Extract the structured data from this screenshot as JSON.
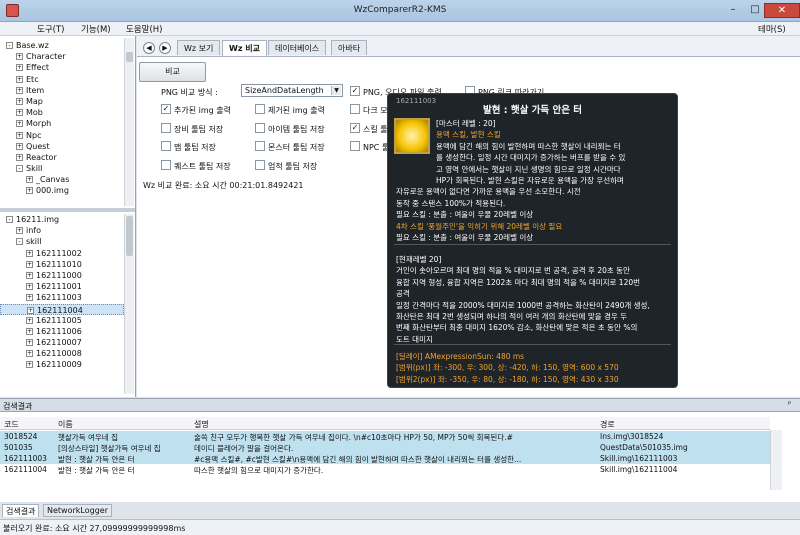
{
  "window": {
    "title": "WzComparerR2-KMS",
    "minimize": "–",
    "maximize": "□",
    "close": "✕"
  },
  "menu": {
    "tools": "도구(T)",
    "functions": "기능(M)",
    "help": "도움말(H)",
    "theme": "테마(S)"
  },
  "tree_top": {
    "items": [
      {
        "label": "Base.wz",
        "indent": 0,
        "exp": "-"
      },
      {
        "label": "Character",
        "indent": 1,
        "exp": "+"
      },
      {
        "label": "Effect",
        "indent": 1,
        "exp": "+"
      },
      {
        "label": "Etc",
        "indent": 1,
        "exp": "+"
      },
      {
        "label": "Item",
        "indent": 1,
        "exp": "+"
      },
      {
        "label": "Map",
        "indent": 1,
        "exp": "+"
      },
      {
        "label": "Mob",
        "indent": 1,
        "exp": "+"
      },
      {
        "label": "Morph",
        "indent": 1,
        "exp": "+"
      },
      {
        "label": "Npc",
        "indent": 1,
        "exp": "+"
      },
      {
        "label": "Quest",
        "indent": 1,
        "exp": "+"
      },
      {
        "label": "Reactor",
        "indent": 1,
        "exp": "+"
      },
      {
        "label": "Skill",
        "indent": 1,
        "exp": "-"
      },
      {
        "label": "_Canvas",
        "indent": 2,
        "exp": "+"
      },
      {
        "label": "000.img",
        "indent": 2,
        "exp": "+"
      }
    ]
  },
  "tree_bottom": {
    "items": [
      {
        "label": "16211.img",
        "indent": 0,
        "exp": "-"
      },
      {
        "label": "info",
        "indent": 1,
        "exp": "+"
      },
      {
        "label": "skill",
        "indent": 1,
        "exp": "-"
      },
      {
        "label": "162111002",
        "indent": 2,
        "exp": "+"
      },
      {
        "label": "162111010",
        "indent": 2,
        "exp": "+"
      },
      {
        "label": "162111000",
        "indent": 2,
        "exp": "+"
      },
      {
        "label": "162111001",
        "indent": 2,
        "exp": "+"
      },
      {
        "label": "162111003",
        "indent": 2,
        "exp": "+"
      },
      {
        "label": "162111004",
        "indent": 2,
        "exp": "+",
        "selected": true
      },
      {
        "label": "162111005",
        "indent": 2,
        "exp": "+"
      },
      {
        "label": "162111006",
        "indent": 2,
        "exp": "+"
      },
      {
        "label": "162110007",
        "indent": 2,
        "exp": "+"
      },
      {
        "label": "162110008",
        "indent": 2,
        "exp": "+"
      },
      {
        "label": "162110009",
        "indent": 2,
        "exp": "+"
      }
    ]
  },
  "tabs": [
    "Wz 보기",
    "Wz 비교",
    "데이터베이스",
    "아바타"
  ],
  "compare": {
    "compare_button": "비교",
    "png_mode_label": "PNG 비교 방식 :",
    "png_mode_value": "SizeAndDataLength",
    "opt_png_audio": "PNG, 오디오 파일 출력",
    "opt_png_link": "PNG 링크 따라가기",
    "opt_added_img": "추가된 img 출력",
    "opt_removed_img": "제거된 img 출력",
    "opt_other": "다크 모드",
    "opt_equip": "장비 툴팁 저장",
    "opt_item": "아이템 툴팁 저장",
    "opt_skill": "스킬 툴팁 저장",
    "opt_map": "맵 툴팁 저장",
    "opt_mob": "몬스터 툴팁 저장",
    "opt_npc": "NPC 툴팁 저장",
    "opt_quest": "퀘스트 툴팁 저장",
    "opt_achievement": "업적 툴팁 저장",
    "status": "Wz 비교 완료: 소요 시간 00:21:01.8492421"
  },
  "tooltip": {
    "id": "162111003",
    "title": "발현 : 햇살 가득 안은 터",
    "lines": [
      {
        "text": "[마스터 레벨 : 20]",
        "cls": ""
      },
      {
        "text": "용맥 스킬, 발현 스킬",
        "cls": "orange"
      },
      {
        "text": "용맥에 담긴 해의 힘이 발현하며 따스한 햇살이 내리쬐는 터",
        "cls": ""
      },
      {
        "text": "를 생성한다. 일정 시간 대미지가 증가하는 버프를 받을 수 있",
        "cls": ""
      },
      {
        "text": "고 영역 안에서는 햇살이 지닌 생명의 힘으로 일정 시간마다",
        "cls": ""
      },
      {
        "text": "HP가 회복된다. 발현 스킬은 자유로운 용맥을 가장 우선하며",
        "cls": ""
      },
      {
        "text": "자유로운 용맥이 없다면 가까운 용맥을 우선 소모한다. 시전",
        "cls": ""
      },
      {
        "text": "동작 중 스탠스 100%가 적용된다.",
        "cls": ""
      },
      {
        "text": "필요 스킬 : 분출 : 여울이 우물 20레벨 이상",
        "cls": ""
      },
      {
        "text": "4차 스킬 '풍월주인'을 익히기 위해 20레벨 이상 필요",
        "cls": "orange"
      },
      {
        "text": "필요 스킬 : 분출 : 여울이 우물 20레벨 이상",
        "cls": ""
      }
    ],
    "lines2": [
      {
        "text": "[현재레벨 20]",
        "cls": ""
      },
      {
        "text": "거인이 솟아오르며 최대 명의 적을 % 대미지로 번 공격, 공격 후 20초 동안",
        "cls": ""
      },
      {
        "text": "융합 지역 형성, 융합 지역은 1202초 마다 최대 명의 적을 % 대미지로 120번",
        "cls": ""
      },
      {
        "text": "공격",
        "cls": ""
      },
      {
        "text": "일정 간격마다 적을 2000% 대미지로 1000번 공격하는 화산탄이 2490개 생성,",
        "cls": ""
      },
      {
        "text": "화산탄은 최대 2번 생성되며 하나의 적이 여러 개의 화산탄에 맞을 경우 두",
        "cls": ""
      },
      {
        "text": "번째 화산탄부터 최종 대미지 1620% 감소, 화산탄에 맞은 적은 초 동안 %의",
        "cls": ""
      },
      {
        "text": "도트 대미지",
        "cls": ""
      }
    ],
    "lines3": [
      {
        "text": "[딜레이] AMexpressionSun: 480 ms",
        "cls": "orange"
      },
      {
        "text": "[범위(px)] 좌: -300, 우: 300, 상: -420, 하: 150, 영역: 600 x 570",
        "cls": "orange"
      },
      {
        "text": "[범위2(px)] 좌: -350, 우: 80, 상: -180, 하: 150, 영역: 430 x 330",
        "cls": "orange"
      }
    ]
  },
  "results": {
    "header": "검색결과",
    "pin": "ᴾ",
    "columns": {
      "code": "코드",
      "name": "이름",
      "desc": "설명",
      "path": "경로"
    },
    "rows": [
      {
        "code": "3018524",
        "name": "햇살가득 여우네 집",
        "desc": "술쓱 친구 모두가 행복한 햇살 가득 여우네 집이다. \\n#c10초마다 HP가 50, MP가 50씩 회복된다.#",
        "path": "Ins.img\\3018524"
      },
      {
        "code": "501035",
        "name": "[의상스타일] 햇살가득 여우네 집",
        "desc": "데이디 블레어가 말을 걸어온다.",
        "path": "QuestData\\501035.img"
      },
      {
        "code": "162111003",
        "name": "발현 : 햇살 가득 안은 터",
        "desc": "#c용맥 스킬#, #c발현 스킬#\\n용맥에 담긴 해의 힘이 발현하며 따스한 햇살이 내리쬐는 터를 생성한...",
        "path": "Skill.img\\162111003"
      },
      {
        "code": "162111004",
        "name": "발현 : 햇살 가득 안은 터",
        "desc": "따스한 햇살의 힘으로 대미지가 증가한다.",
        "path": "Skill.img\\162111004"
      }
    ]
  },
  "bottom_tabs": [
    "검색결과",
    "NetworkLogger"
  ],
  "statusbar": "불러오기 완료: 소요 시간 27,09999999999998ms",
  "colors": {
    "accent": "#f2a32d",
    "tooltip_bg": "#1f2429",
    "row_highlight": "#bfe0ef"
  }
}
